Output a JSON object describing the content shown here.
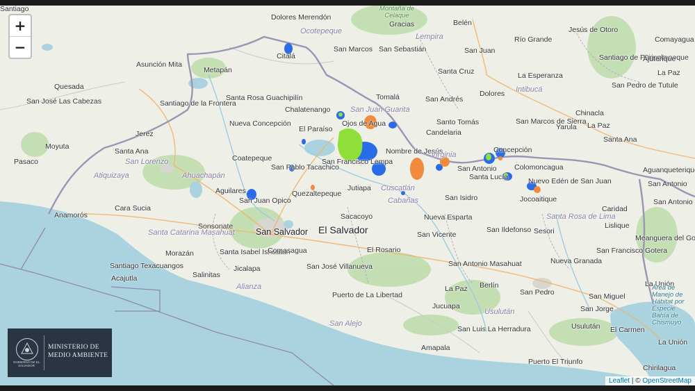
{
  "controls": {
    "zoom_in": "+",
    "zoom_out": "−"
  },
  "logo": {
    "ministry": "MINISTERIO DE MEDIO AMBIENTE",
    "seal_caption": "GOBIERNO DE EL SALVADOR"
  },
  "attribution": {
    "leaflet": "Leaflet",
    "separator": " | © ",
    "osm": "OpenStreetMap"
  },
  "colors": {
    "sea": "#aad3df",
    "land": "#eef0e8",
    "forest": "#bcdcaa",
    "urban": "#dcdcd6",
    "border": "#9d94b4",
    "radar_blue": "#2a6be8",
    "radar_green": "#8ee039",
    "radar_orange": "#f08a3c"
  },
  "labels": {
    "country": "El Salvador",
    "capital": "San Salvador",
    "cities": [
      "Dolores Merendón",
      "Ocotepeque",
      "Citalá",
      "San Marcos",
      "San Sebastián",
      "Belén",
      "Río Grande",
      "Jesús de Otoro",
      "Comayagua",
      "Siguatepeque",
      "Lempira",
      "Gracias",
      "La Esperanza",
      "Intibucá",
      "San Juan",
      "Santiago de Puringla",
      "Ajuterique",
      "La Paz",
      "San Pedro de Tutule",
      "Metapán",
      "Santa Rosa Guachipilín",
      "Chalatenango",
      "San Juan Guarita",
      "Ojos de Agua",
      "Tomalá",
      "San Andrés",
      "Dolores",
      "Santo Tomás",
      "Candelaria",
      "San Marcos de Sierra",
      "Chinacla",
      "Yarula",
      "La Paz",
      "Santa Ana",
      "Santa Cruz",
      "Nueva Concepción",
      "El Paraíso",
      "San Francisco Lempa",
      "Nombre de Jesús",
      "Virginia",
      "Concepción",
      "Colomoncagua",
      "San Antonio",
      "Santa Lucía",
      "Aguanqueterique",
      "Jutiapa",
      "Jerez",
      "Moyuta",
      "Pasaco",
      "Quesada",
      "Asunción Mita",
      "San José Las Cabezas",
      "Santiago de la Frontera",
      "Santa Ana",
      "San Lorenzo",
      "Atiquizaya",
      "Ahuachapán",
      "Coatepeque",
      "San Pablo Tacachico",
      "Aguilares",
      "San Juan Opico",
      "Quezaltepeque",
      "Cuscatlán",
      "Cabañas",
      "San Isidro",
      "Nuevo Edén de San Juan",
      "Jocoaitique",
      "San Antonio",
      "San Antonio del Norte",
      "Caridad",
      "Lislique",
      "Anamorós",
      "Cara Sucia",
      "Santa Catarina Masahuat",
      "Sonsonate",
      "Sacacoyo",
      "El Rosario",
      "San Vicente",
      "San Ildefonso",
      "Sesori",
      "San Francisco Gotera",
      "Santa Rosa de Lima",
      "Morazán",
      "Santa Isabel Ishuatán",
      "Comasagua",
      "Santiago Texacuangos",
      "Acajutla",
      "Salinitas",
      "Jicalapa",
      "San José Villanueva",
      "San Antonio Masahuat",
      "Nueva Granada",
      "San Pedro",
      "San Miguel",
      "La Unión",
      "Alianza",
      "Puerto de La Libertad",
      "La Paz",
      "Berlín",
      "Jucuapa",
      "Usulután",
      "San Jorge",
      "San Alejo",
      "San Luis La Herradura",
      "Usulután",
      "El Carmen",
      "La Unión",
      "Amapala",
      "Puerto El Triunfo",
      "Chirilagua",
      "Meanguera del Golfo",
      "Nueva Esparta",
      "Santiago"
    ],
    "water": [
      "Área de Manejo de Hábitat por Especie Bahía de Chismuyo"
    ],
    "park": [
      "Montaña de Celaque"
    ]
  }
}
